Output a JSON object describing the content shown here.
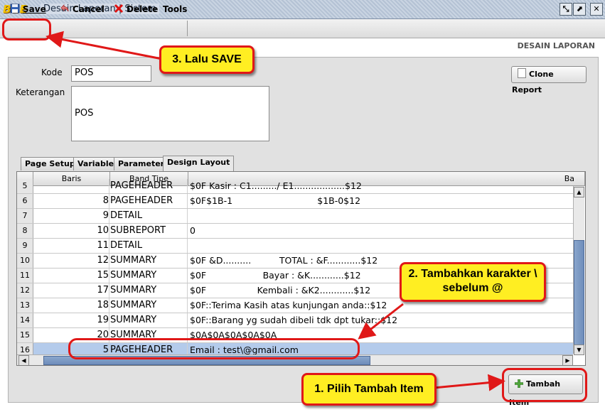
{
  "window": {
    "logo_text": "BEE",
    "title": "Desain Laporan | Sistem",
    "controls": [
      "restore-icon",
      "maximize-icon",
      "close-icon"
    ]
  },
  "toolbar": {
    "save_label": "Save",
    "cancel_label": "Cancel",
    "delete_label": "Delete",
    "tools_label": "Tools"
  },
  "header": {
    "section_title": "DESAIN LAPORAN"
  },
  "form": {
    "kode_label": "Kode",
    "kode_value": "POS",
    "keterangan_label": "Keterangan",
    "keterangan_value": "POS",
    "clone_button": "Clone Report"
  },
  "tabs": [
    {
      "label": "Page Setup",
      "active": false
    },
    {
      "label": "Variable",
      "active": false
    },
    {
      "label": "Parameter",
      "active": false
    },
    {
      "label": "Design Layout",
      "active": true
    }
  ],
  "grid": {
    "columns": [
      "Baris",
      "Band Tipe",
      "Ba"
    ],
    "rows": [
      {
        "num": "5",
        "baris": "",
        "band": "PAGEHEADER",
        "bar": "$0F Kasir : C1........./ E1..................$12"
      },
      {
        "num": "6",
        "baris": "8",
        "band": "PAGEHEADER",
        "bar": "$0F$1B-1                              $1B-0$12"
      },
      {
        "num": "7",
        "baris": "9",
        "band": "DETAIL",
        "bar": ""
      },
      {
        "num": "8",
        "baris": "10",
        "band": "SUBREPORT",
        "bar": "0"
      },
      {
        "num": "9",
        "baris": "11",
        "band": "DETAIL",
        "bar": ""
      },
      {
        "num": "10",
        "baris": "12",
        "band": "SUMMARY",
        "bar": "$0F &D..........          TOTAL : &F............$12"
      },
      {
        "num": "11",
        "baris": "15",
        "band": "SUMMARY",
        "bar": "$0F                    Bayar : &K............$12"
      },
      {
        "num": "12",
        "baris": "17",
        "band": "SUMMARY",
        "bar": "$0F                  Kembali : &K2............$12"
      },
      {
        "num": "13",
        "baris": "18",
        "band": "SUMMARY",
        "bar": "$0F::Terima Kasih atas kunjungan anda::$12"
      },
      {
        "num": "14",
        "baris": "19",
        "band": "SUMMARY",
        "bar": "$0F::Barang yg sudah dibeli tdk dpt tukar::$12"
      },
      {
        "num": "15",
        "baris": "20",
        "band": "SUMMARY",
        "bar": "$0A$0A$0A$0A$0A"
      },
      {
        "num": "16",
        "baris": "5",
        "band": "PAGEHEADER",
        "bar": "Email : test\\@gmail.com",
        "selected": true
      }
    ]
  },
  "tambah_button": "Tambah Item",
  "annotations": {
    "step1": "1. Pilih Tambah Item",
    "step2": "2. Tambahkan karakter \\ sebelum @",
    "step3": "3. Lalu SAVE"
  },
  "colors": {
    "annotation_fill": "#ffee22",
    "annotation_border": "#e01818",
    "selected_row": "#b4cbeb"
  }
}
